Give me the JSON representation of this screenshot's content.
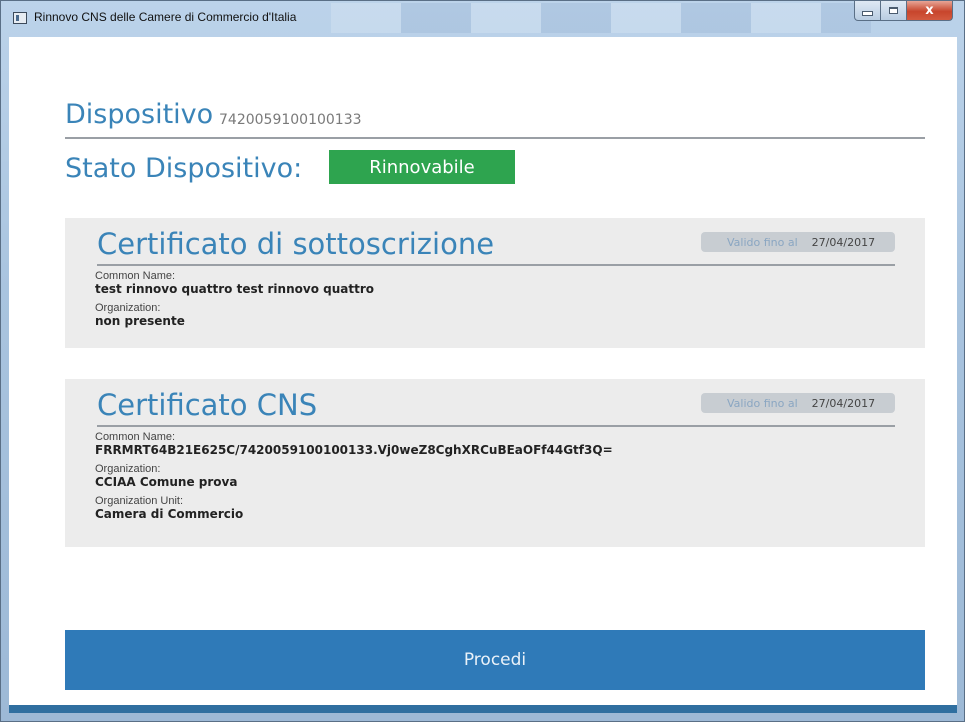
{
  "window": {
    "title": "Rinnovo CNS delle Camere di Commercio d'Italia",
    "close_glyph": "x"
  },
  "device": {
    "label": "Dispositivo",
    "serial": "7420059100100133",
    "status_label": "Stato Dispositivo:",
    "status_value": "Rinnovabile",
    "status_color": "#2ea44f"
  },
  "certificates": [
    {
      "title": "Certificato di sottoscrizione",
      "valid_label": "Valido fino al",
      "valid_date": "27/04/2017",
      "fields": [
        {
          "label": "Common Name:",
          "value": "test rinnovo quattro test rinnovo quattro"
        },
        {
          "label": "Organization:",
          "value": "non presente"
        }
      ]
    },
    {
      "title": "Certificato CNS",
      "valid_label": "Valido fino al",
      "valid_date": "27/04/2017",
      "fields": [
        {
          "label": "Common Name:",
          "value": "FRRMRT64B21E625C/7420059100100133.Vj0weZ8CghXRCuBEaOFf44Gtf3Q="
        },
        {
          "label": "Organization:",
          "value": "CCIAA Comune prova"
        },
        {
          "label": "Organization Unit:",
          "value": "Camera di Commercio"
        }
      ]
    }
  ],
  "actions": {
    "proceed_label": "Procedi"
  },
  "colors": {
    "accent": "#3a84b8",
    "button": "#2f7ab8",
    "card_bg": "#ececec"
  }
}
